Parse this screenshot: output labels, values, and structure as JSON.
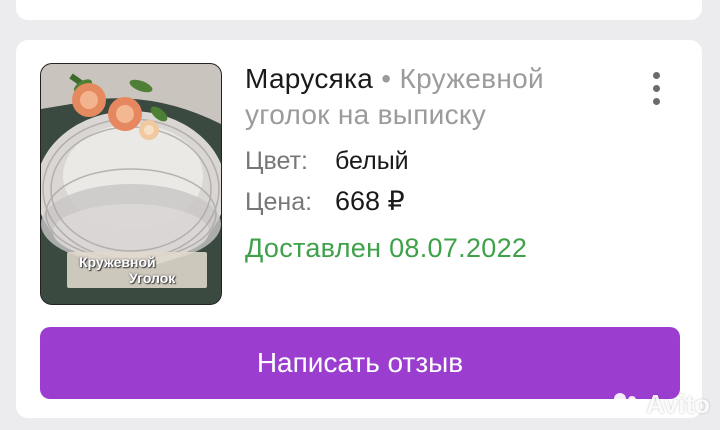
{
  "order": {
    "seller": "Марусяка",
    "separator": "•",
    "product_line1": "Кружевной",
    "product_line2": "уголок на выписку",
    "color_label": "Цвет:",
    "color_value": "белый",
    "price_label": "Цена:",
    "price_value": "668 ₽",
    "status": "Доставлен 08.07.2022",
    "status_color": "#3fa14a",
    "thumbnail_caption_line1": "Кружевной",
    "thumbnail_caption_line2": "Уголок"
  },
  "actions": {
    "review_button_label": "Написать отзыв",
    "review_button_color": "#9b3ecf",
    "menu_icon": "more-vertical-icon"
  },
  "watermark": {
    "text": "Avito"
  }
}
